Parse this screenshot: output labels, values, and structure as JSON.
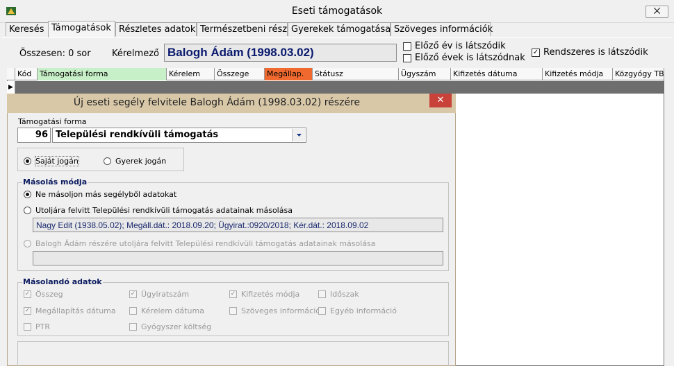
{
  "window": {
    "title": "Eseti támogatások",
    "close": "⨉"
  },
  "tabs": [
    {
      "label": "Keresés"
    },
    {
      "label": "Támogatások"
    },
    {
      "label": "Részletes adatok"
    },
    {
      "label": "Természetbeni rész"
    },
    {
      "label": "Gyerekek támogatásai"
    },
    {
      "label": "Szöveges információk"
    }
  ],
  "summary": {
    "total": "Összesen: 0 sor",
    "applicant_label": "Kérelmező",
    "applicant_name": "Balogh Ádám (1998.03.02)",
    "opt_prev_year": "Előző év is látszódik",
    "opt_prev_years": "Előző évek is látszódnak",
    "opt_regular": "Rendszeres is látszódik",
    "opt_regular_checked": true
  },
  "grid": {
    "columns": [
      "Kód",
      "Támogatási forma",
      "Kérelem",
      "Összege",
      "Megállap.",
      "Státusz",
      "Ügyszám",
      "Kifizetés dátuma",
      "Kifizetés módja",
      "Közgyógy TB"
    ],
    "row_indicator": "▶",
    "header_colors": {
      "forma": "#c8f0c8",
      "megallap": "#f06a30"
    }
  },
  "dialog": {
    "title": "Új eseti segély felvitele Balogh Ádám (1998.03.02) részére",
    "close": "✕",
    "form_label": "Támogatási forma",
    "form_code": "96",
    "form_value": "Települési rendkívüli támogatás",
    "basis": {
      "own": "Saját jogán",
      "child": "Gyerek jogán"
    },
    "copy_mode": {
      "legend": "Másolás módja",
      "opt1": "Ne másoljon más segélyből adatokat",
      "opt2": "Utoljára felvitt Települési rendkívüli támogatás adatainak másolása",
      "opt2_value": "Nagy Edit (1938.05.02); Megáll.dát.: 2018.09.20; Ügyirat.:0920/2018; Kér.dát.: 2018.09.02",
      "opt3": "Balogh Ádám részére utoljára felvitt Települési rendkívüli támogatás adatainak másolása",
      "opt3_value": ""
    },
    "copy_data": {
      "legend": "Másolandó adatok",
      "items": [
        "Összeg",
        "Ügyiratszám",
        "Kifizetés módja",
        "Időszak",
        "Megállapítás dátuma",
        "Kérelem dátuma",
        "Szöveges információk",
        "Egyéb információ",
        "PTR",
        "Gyógyszer költség"
      ]
    }
  }
}
